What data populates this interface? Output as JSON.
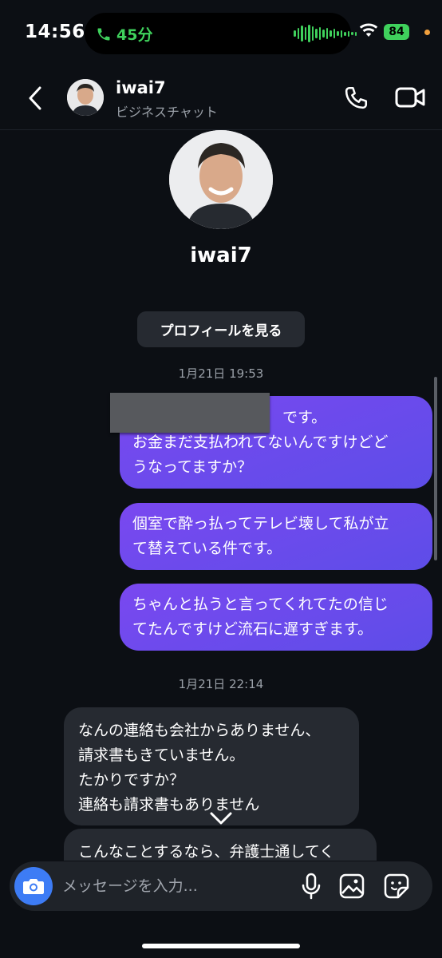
{
  "status_bar": {
    "time": "14:56",
    "call_duration": "45分",
    "battery": "84",
    "accent_green": "#3fd15c",
    "battery_dot_color": "#f2a03d"
  },
  "header": {
    "name": "iwai7",
    "subtitle": "ビジネスチャット",
    "icons": [
      "back-chevron-icon",
      "phone-icon",
      "video-camera-icon"
    ]
  },
  "profile": {
    "name": "iwai7",
    "view_profile_label": "プロフィールを見る"
  },
  "timestamps": {
    "first": "1月21日 19:53",
    "second": "1月21日 22:14"
  },
  "outgoing_messages": [
    {
      "lines": [
        "です。",
        "お金まだ支払われてないんですけどど",
        "うなってますか？"
      ],
      "redacted_prefix": true
    },
    {
      "lines": [
        "個室で酔っ払ってテレビ壊して私が立",
        "て替えている件です。"
      ]
    },
    {
      "lines": [
        "ちゃんと払うと言ってくれてたの信じ",
        "てたんですけど流石に遅すぎます。"
      ]
    }
  ],
  "incoming_messages": [
    {
      "lines": [
        "なんの連絡も会社からありません、",
        "請求書もきていません。",
        "たかりですか？",
        "連絡も請求書もありません"
      ]
    },
    {
      "lines": [
        "こんなことするなら、弁護士通してく"
      ]
    }
  ],
  "composer": {
    "placeholder": "メッセージを入力...",
    "icons": [
      "camera-icon",
      "microphone-icon",
      "gallery-icon",
      "sticker-icon"
    ]
  },
  "colors": {
    "background": "#0c0f14",
    "outgoing_bubble_start": "#7a48f0",
    "outgoing_bubble_end": "#5d4de8",
    "incoming_bubble": "#262a31",
    "camera_button": "#3d7cf5"
  }
}
